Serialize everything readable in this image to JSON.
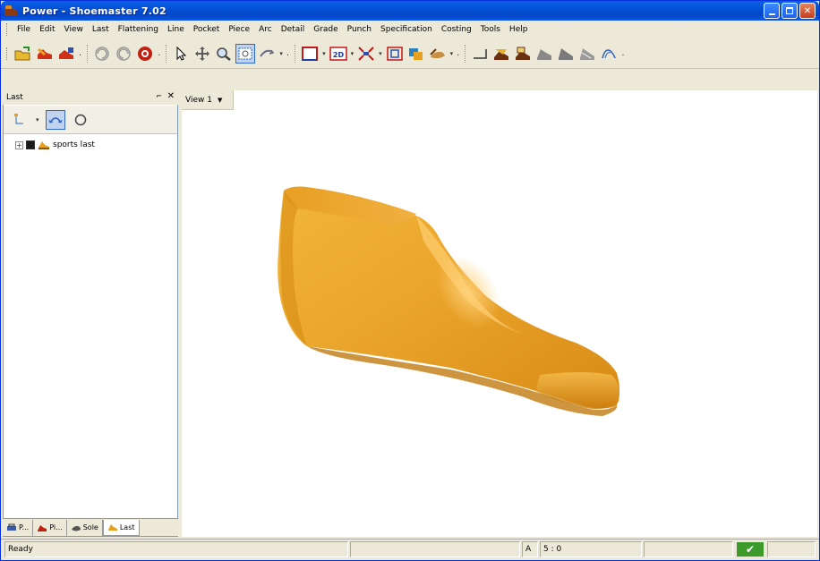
{
  "window": {
    "title": "Power - Shoemaster 7.02"
  },
  "menu": {
    "items": [
      "File",
      "Edit",
      "View",
      "Last",
      "Flattening",
      "Line",
      "Pocket",
      "Piece",
      "Arc",
      "Detail",
      "Grade",
      "Punch",
      "Specification",
      "Costing",
      "Tools",
      "Help"
    ]
  },
  "left_panel": {
    "title": "Last",
    "pin_glyph": "⌐",
    "close_glyph": "✕",
    "tree_item": "sports last",
    "tabs": [
      "P...",
      "Pi...",
      "Sole",
      "Last"
    ]
  },
  "view": {
    "tab_label": "View 1"
  },
  "status": {
    "left": "Ready",
    "cell_a": "A",
    "cell_b": "5 : 0"
  },
  "colors": {
    "accent": "#316ac5",
    "last_body": "#e8a020"
  }
}
